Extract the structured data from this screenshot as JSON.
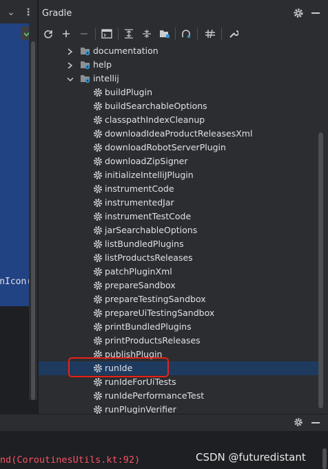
{
  "panel": {
    "title": "Gradle"
  },
  "editor": {
    "code_fragment": "onIcon()",
    "error_fragment": "nd(CoroutinesUtils.kt:92)"
  },
  "toolbar": {
    "buttons": [
      "refresh-icon",
      "add-icon",
      "remove-icon",
      "toggle-offline-icon",
      "expand-all-icon",
      "collapse-all-icon",
      "group-modules-icon",
      "link-icon",
      "toggle-skip-tests-icon",
      "settings-wrench-icon"
    ]
  },
  "tree": {
    "groups": [
      {
        "label": "documentation",
        "expanded": false
      },
      {
        "label": "help",
        "expanded": false
      },
      {
        "label": "intellij",
        "expanded": true
      }
    ],
    "tasks": [
      "buildPlugin",
      "buildSearchableOptions",
      "classpathIndexCleanup",
      "downloadIdeaProductReleasesXml",
      "downloadRobotServerPlugin",
      "downloadZipSigner",
      "initializeIntelliJPlugin",
      "instrumentCode",
      "instrumentedJar",
      "instrumentTestCode",
      "jarSearchableOptions",
      "listBundledPlugins",
      "listProductsReleases",
      "patchPluginXml",
      "prepareSandbox",
      "prepareTestingSandbox",
      "prepareUiTestingSandbox",
      "printBundledPlugins",
      "printProductsReleases",
      "publishPlugin",
      "runIde",
      "runIdeForUiTests",
      "runIdePerformanceTest",
      "runPluginVerifier"
    ],
    "selected_task": "runIde"
  },
  "watermark": "CSDN @futuredistant",
  "colors": {
    "selection": "#1f3a5f",
    "highlight_box": "#e8211a",
    "error_text": "#f75464"
  }
}
